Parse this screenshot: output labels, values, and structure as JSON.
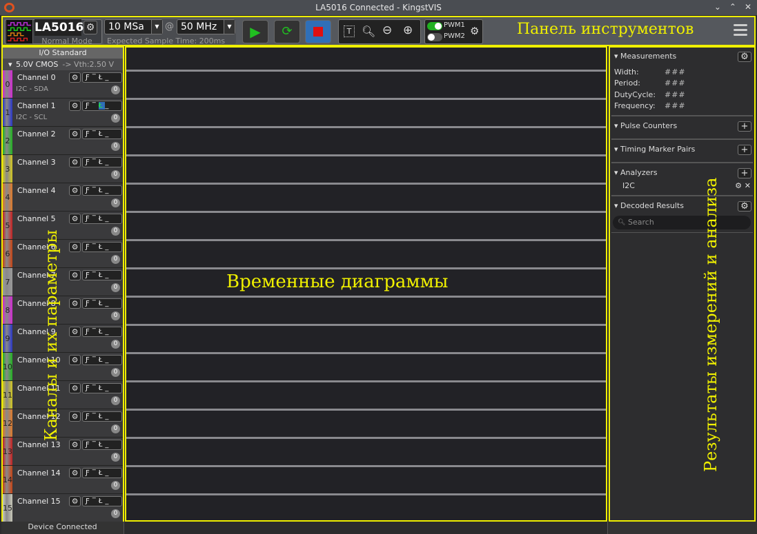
{
  "window": {
    "title": "LA5016 Connected - KingstVIS"
  },
  "toolbar": {
    "device": "LA5016",
    "mode": "Normal Mode",
    "sample_depth": "10 MSa",
    "at": "@",
    "sample_rate": "50 MHz",
    "expected_time": "Expected Sample Time: 200ms",
    "pwm1": "PWM1",
    "pwm2": "PWM2",
    "pwm1_on": true,
    "pwm2_on": false,
    "annotation": "Панель инструментов"
  },
  "io": {
    "header": "I/O Standard",
    "standard": "5.0V CMOS",
    "vth": "-> Vth:2.50 V"
  },
  "channels": [
    {
      "name": "Channel 0",
      "num": "0",
      "sub": "I2C - SDA",
      "count": "0",
      "color": "#d22ad2"
    },
    {
      "name": "Channel 1",
      "num": "1",
      "sub": "I2C - SCL",
      "count": "0",
      "color": "#2a36c8"
    },
    {
      "name": "Channel 2",
      "num": "2",
      "sub": "",
      "count": "0",
      "color": "#22b422"
    },
    {
      "name": "Channel 3",
      "num": "3",
      "sub": "",
      "count": "0",
      "color": "#d2c822"
    },
    {
      "name": "Channel 4",
      "num": "4",
      "sub": "",
      "count": "0",
      "color": "#e07a2a"
    },
    {
      "name": "Channel 5",
      "num": "5",
      "sub": "",
      "count": "0",
      "color": "#c82222"
    },
    {
      "name": "Channel 6",
      "num": "6",
      "sub": "",
      "count": "0",
      "color": "#c84414"
    },
    {
      "name": "Channel 7",
      "num": "7",
      "sub": "",
      "count": "0",
      "color": "#9a9a9a"
    },
    {
      "name": "Channel 8",
      "num": "8",
      "sub": "",
      "count": "0",
      "color": "#d22ad2"
    },
    {
      "name": "Channel 9",
      "num": "9",
      "sub": "",
      "count": "0",
      "color": "#2a36c8"
    },
    {
      "name": "Channel 10",
      "num": "10",
      "sub": "",
      "count": "0",
      "color": "#22b422"
    },
    {
      "name": "Channel 11",
      "num": "11",
      "sub": "",
      "count": "0",
      "color": "#d2c822"
    },
    {
      "name": "Channel 12",
      "num": "12",
      "sub": "",
      "count": "0",
      "color": "#e07a2a"
    },
    {
      "name": "Channel 13",
      "num": "13",
      "sub": "",
      "count": "0",
      "color": "#c82222"
    },
    {
      "name": "Channel 14",
      "num": "14",
      "sub": "",
      "count": "0",
      "color": "#c84414"
    },
    {
      "name": "Channel 15",
      "num": "15",
      "sub": "",
      "count": "0",
      "color": "#c8c8b8"
    }
  ],
  "annotations": {
    "channels": "Каналы и их параметры",
    "waveforms": "Временные диаграммы",
    "results": "Результаты измерений и анализа"
  },
  "measurements": {
    "title": "Measurements",
    "rows": [
      {
        "label": "Width:",
        "value": "###"
      },
      {
        "label": "Period:",
        "value": "###"
      },
      {
        "label": "DutyCycle:",
        "value": "###"
      },
      {
        "label": "Frequency:",
        "value": "###"
      }
    ]
  },
  "pulse_counters": "Pulse Counters",
  "timing_markers": "Timing Marker Pairs",
  "analyzers": {
    "title": "Analyzers",
    "items": [
      "I2C"
    ]
  },
  "decoded": {
    "title": "Decoded Results",
    "search_placeholder": "Search"
  },
  "status": "Device Connected",
  "accent": "#f0f000"
}
